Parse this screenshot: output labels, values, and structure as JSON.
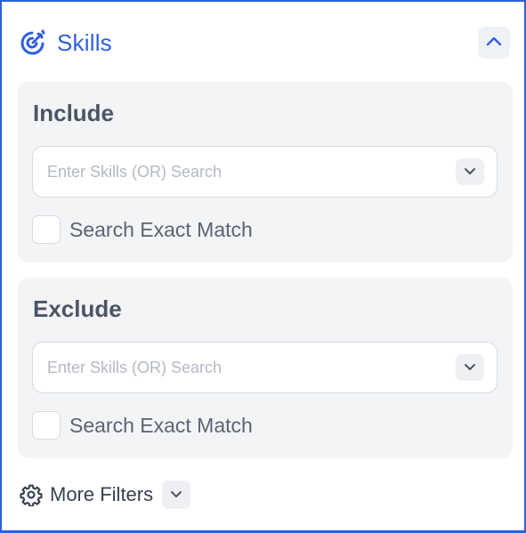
{
  "header": {
    "title": "Skills",
    "icon": "skills-target-icon",
    "collapse_icon": "chevron-up-icon",
    "accent_color": "#2f5fe0"
  },
  "include": {
    "title": "Include",
    "placeholder": "Enter Skills (OR) Search",
    "dropdown_icon": "chevron-down-icon",
    "exact_match_label": "Search Exact Match",
    "exact_match_checked": false
  },
  "exclude": {
    "title": "Exclude",
    "placeholder": "Enter Skills (OR) Search",
    "dropdown_icon": "chevron-down-icon",
    "exact_match_label": "Search Exact Match",
    "exact_match_checked": false
  },
  "more_filters": {
    "label": "More Filters",
    "icon": "gear-icon",
    "toggle_icon": "chevron-down-icon"
  }
}
